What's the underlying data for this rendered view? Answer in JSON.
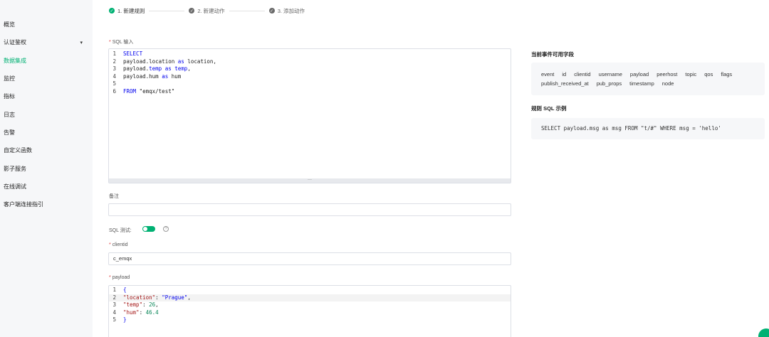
{
  "sidebar": {
    "items": [
      {
        "label": "概览",
        "active": false
      },
      {
        "label": "认证鉴权",
        "active": false,
        "has_caret": true
      },
      {
        "label": "数据集成",
        "active": true
      },
      {
        "label": "监控",
        "active": false
      },
      {
        "label": "指标",
        "active": false
      },
      {
        "label": "日志",
        "active": false
      },
      {
        "label": "告警",
        "active": false
      },
      {
        "label": "自定义函数",
        "active": false
      },
      {
        "label": "影子服务",
        "active": false
      },
      {
        "label": "在线调试",
        "active": false
      },
      {
        "label": "客户端连接指引",
        "active": false
      }
    ]
  },
  "steps": [
    {
      "label": "1. 新建规则",
      "state": "done"
    },
    {
      "label": "2. 新建动作",
      "state": "pending"
    },
    {
      "label": "3. 添加动作",
      "state": "pending"
    }
  ],
  "form": {
    "sql_label": "SQL 输入",
    "sql_lines": [
      {
        "n": "1",
        "tokens": [
          {
            "t": "SELECT",
            "c": "kw"
          }
        ]
      },
      {
        "n": "2",
        "tokens": [
          {
            "t": "payload.location ",
            "c": "plain"
          },
          {
            "t": "as",
            "c": "kw"
          },
          {
            "t": " location,",
            "c": "plain"
          }
        ]
      },
      {
        "n": "3",
        "tokens": [
          {
            "t": "payload.",
            "c": "plain"
          },
          {
            "t": "temp",
            "c": "kw"
          },
          {
            "t": " ",
            "c": "plain"
          },
          {
            "t": "as",
            "c": "kw"
          },
          {
            "t": " ",
            "c": "plain"
          },
          {
            "t": "temp",
            "c": "kw"
          },
          {
            "t": ",",
            "c": "plain"
          }
        ]
      },
      {
        "n": "4",
        "tokens": [
          {
            "t": "payload.hum ",
            "c": "plain"
          },
          {
            "t": "as",
            "c": "kw"
          },
          {
            "t": " hum",
            "c": "plain"
          }
        ]
      },
      {
        "n": "5",
        "tokens": []
      },
      {
        "n": "6",
        "tokens": [
          {
            "t": "FROM",
            "c": "kw"
          },
          {
            "t": " \"emqx/test\"",
            "c": "plain"
          }
        ]
      }
    ],
    "resize_handle": "···",
    "note_label": "备注",
    "note_value": "",
    "sql_test_label": "SQL 测试:",
    "sql_test_enabled": true,
    "help_glyph": "?",
    "clientid_label": "clientid",
    "clientid_value": "c_emqx",
    "payload_label": "payload",
    "payload_lines": [
      {
        "n": "1",
        "hl": false,
        "tokens": [
          {
            "t": "{",
            "c": "kw"
          }
        ]
      },
      {
        "n": "2",
        "hl": true,
        "tokens": [
          {
            "t": "\"location\"",
            "c": "jkey"
          },
          {
            "t": ": ",
            "c": "punct"
          },
          {
            "t": "\"Prague\"",
            "c": "kw"
          },
          {
            "t": ",",
            "c": "punct"
          }
        ]
      },
      {
        "n": "3",
        "hl": false,
        "tokens": [
          {
            "t": "\"temp\"",
            "c": "jkey"
          },
          {
            "t": ": ",
            "c": "punct"
          },
          {
            "t": "26",
            "c": "jnum"
          },
          {
            "t": ",",
            "c": "punct"
          }
        ]
      },
      {
        "n": "4",
        "hl": false,
        "tokens": [
          {
            "t": "\"hum\"",
            "c": "jkey"
          },
          {
            "t": ": ",
            "c": "punct"
          },
          {
            "t": "46.4",
            "c": "jnum"
          }
        ]
      },
      {
        "n": "5",
        "hl": false,
        "tokens": [
          {
            "t": "}",
            "c": "kw"
          }
        ]
      }
    ]
  },
  "right_panel": {
    "fields_title": "当前事件可用字段",
    "fields": [
      "event",
      "id",
      "clientid",
      "username",
      "payload",
      "peerhost",
      "topic",
      "qos",
      "flags",
      "publish_received_at",
      "pub_props",
      "timestamp",
      "node"
    ],
    "example_title": "规则 SQL 示例",
    "example_sql": "SELECT payload.msg as msg FROM \"t/#\" WHERE msg = 'hello'"
  },
  "colors": {
    "accent": "#00b173",
    "keyword": "#0000ee",
    "json_key": "#a31515",
    "json_number": "#098658"
  }
}
